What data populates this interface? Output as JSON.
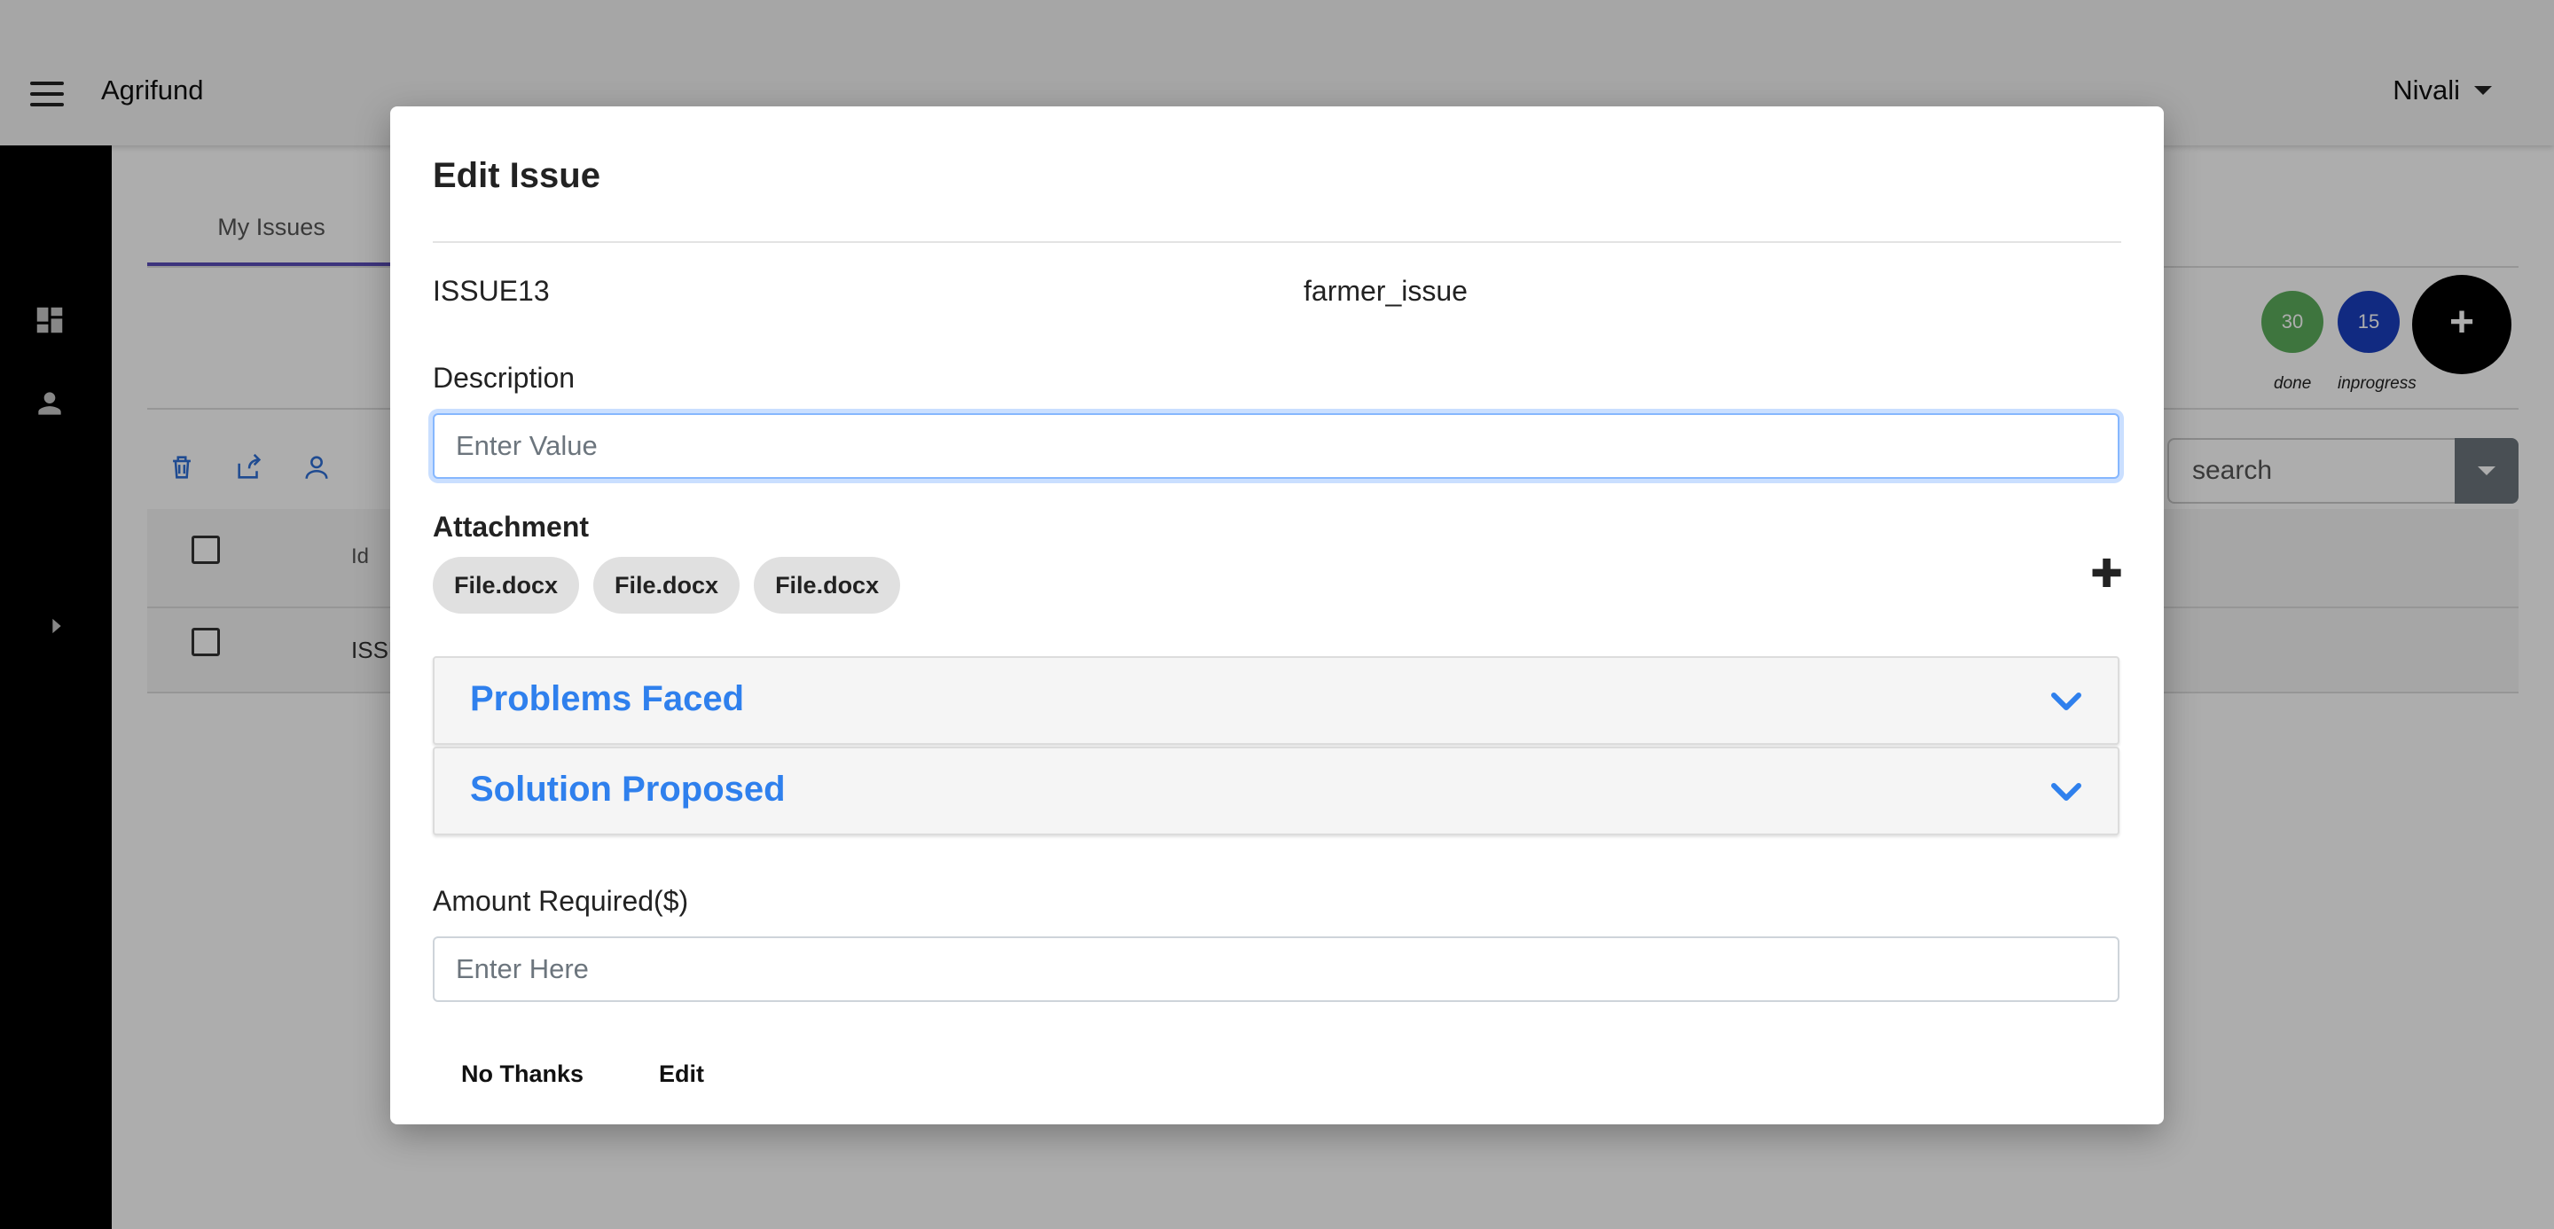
{
  "app": {
    "title": "Agrifund",
    "user": "Nivali"
  },
  "tabs": {
    "my_issues": "My Issues"
  },
  "stats": [
    {
      "count": "30",
      "label": "done",
      "color": "#5cad5c"
    },
    {
      "count": "15",
      "label": "inprogress",
      "color": "#1a3fbf"
    }
  ],
  "add_button": "+",
  "search": {
    "placeholder": "search"
  },
  "table": {
    "header_id": "Id",
    "row_id_partial": "ISSU"
  },
  "modal": {
    "title": "Edit Issue",
    "issue_id": "ISSUE13",
    "issue_type": "farmer_issue",
    "description_label": "Description",
    "description_placeholder": "Enter Value",
    "attachment_label": "Attachment",
    "attachments": [
      "File.docx",
      "File.docx",
      "File.docx"
    ],
    "add_attachment": "✚",
    "accordions": [
      "Problems Faced",
      "Solution Proposed"
    ],
    "amount_label": "Amount Required($)",
    "amount_placeholder": "Enter Here",
    "cancel_label": "No Thanks",
    "confirm_label": "Edit"
  },
  "colors": {
    "accent": "#2f80ed",
    "tab_indicator": "#5b4db8",
    "sidebar": "#000000"
  }
}
